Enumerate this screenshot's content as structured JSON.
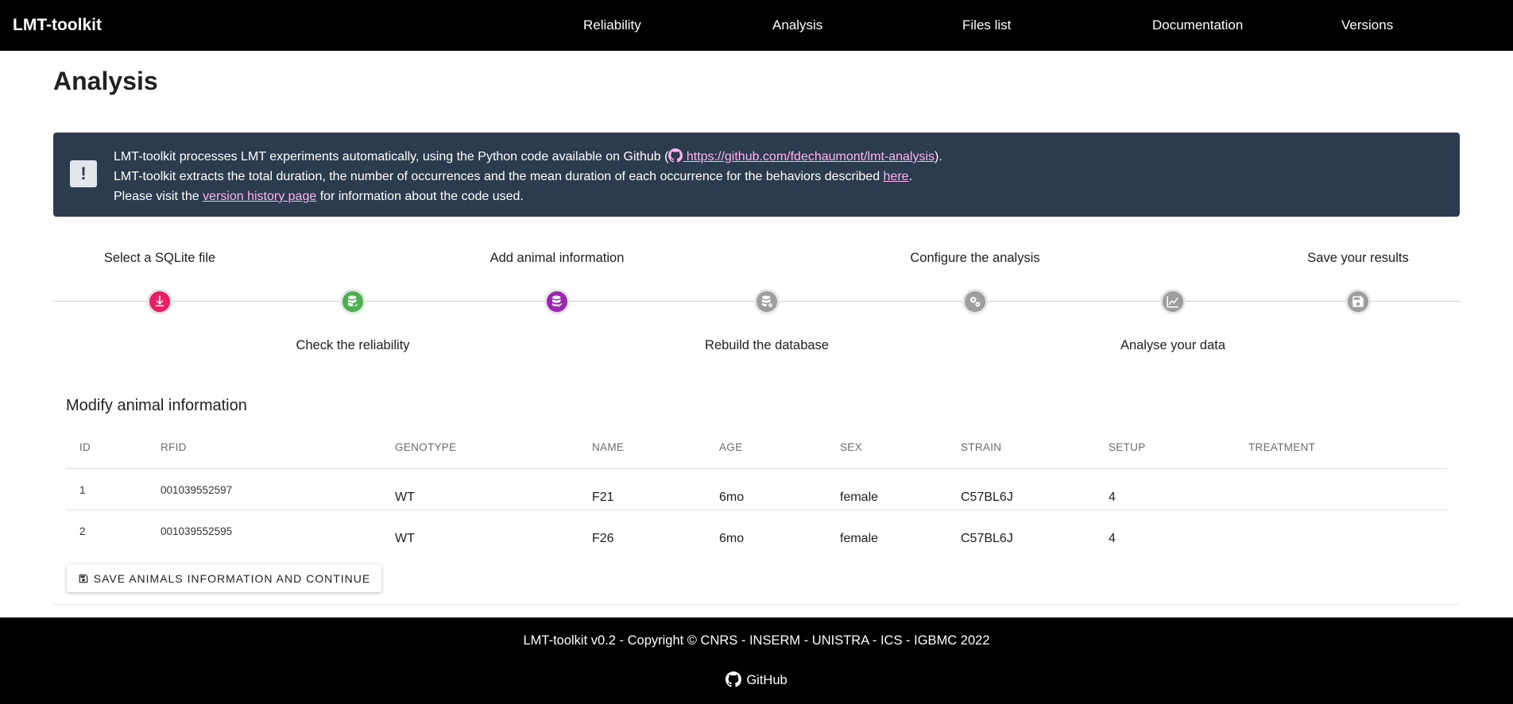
{
  "brand": "LMT-toolkit",
  "nav": [
    "Reliability",
    "Analysis",
    "Files list",
    "Documentation",
    "Versions"
  ],
  "page_title": "Analysis",
  "alert": {
    "icon": "exclamation-icon",
    "line1_prefix": "LMT-toolkit processes LMT experiments automatically, using the Python code available on Github (",
    "line1_link": " https://github.com/fdechaumont/lmt-analysis",
    "line1_suffix": ").",
    "line2_prefix": "LMT-toolkit extracts the total duration, the number of occurrences and the mean duration of each occurrence for the behaviors described ",
    "line2_link": "here",
    "line2_suffix": ".",
    "line3_prefix": "Please visit the ",
    "line3_link": "version history page",
    "line3_suffix": " for information about the code used."
  },
  "stepper": {
    "steps": [
      {
        "label": "Select a SQLite file",
        "icon": "download-icon",
        "color": "#e91e63"
      },
      {
        "label": "Check the reliability",
        "icon": "database-check-icon",
        "color": "#4caf50"
      },
      {
        "label": "Add animal information",
        "icon": "database-edit-icon",
        "color": "#9c27b0"
      },
      {
        "label": "Rebuild the database",
        "icon": "database-cog-icon",
        "color": "#9e9e9e"
      },
      {
        "label": "Configure the analysis",
        "icon": "cogs-icon",
        "color": "#9e9e9e"
      },
      {
        "label": "Analyse your data",
        "icon": "chart-line-icon",
        "color": "#9e9e9e"
      },
      {
        "label": "Save your results",
        "icon": "content-save-icon",
        "color": "#9e9e9e"
      }
    ]
  },
  "table": {
    "title": "Modify animal information",
    "headers": [
      "ID",
      "RFID",
      "GENOTYPE",
      "NAME",
      "AGE",
      "SEX",
      "STRAIN",
      "SETUP",
      "TREATMENT"
    ],
    "rows": [
      [
        "1",
        "001039552597",
        "WT",
        "F21",
        "6mo",
        "female",
        "C57BL6J",
        "4",
        ""
      ],
      [
        "2",
        "001039552595",
        "WT",
        "F26",
        "6mo",
        "female",
        "C57BL6J",
        "4",
        ""
      ]
    ]
  },
  "save_button": "SAVE ANIMALS INFORMATION AND CONTINUE",
  "footer": {
    "copyright": "LMT-toolkit v0.2 - Copyright © CNRS - INSERM - UNISTRA - ICS - IGBMC 2022",
    "github": "GitHub"
  }
}
